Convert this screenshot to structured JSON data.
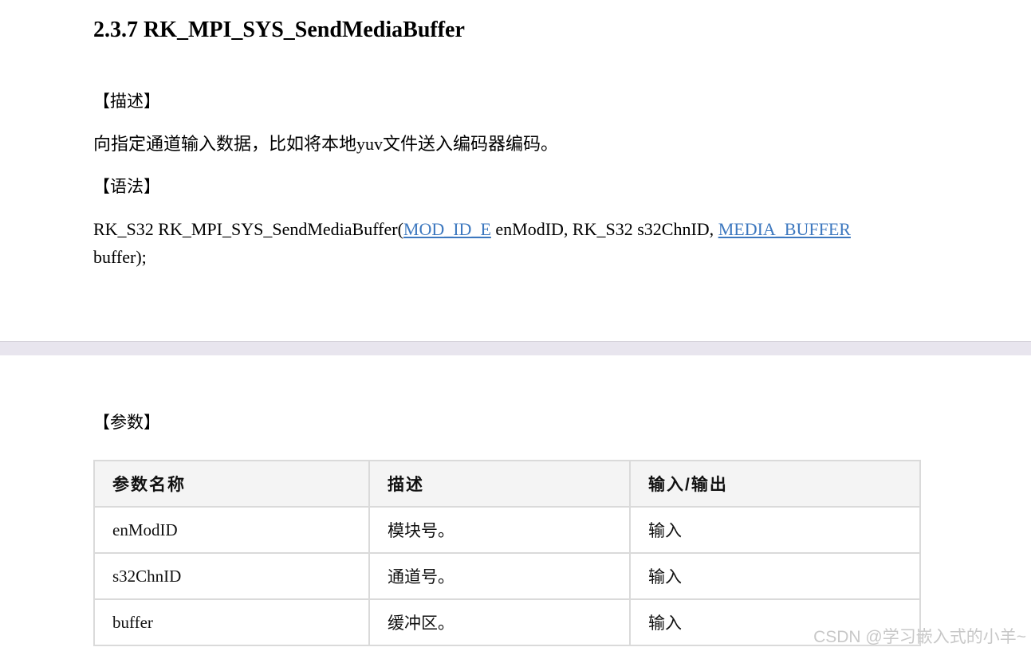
{
  "section": {
    "heading": "2.3.7 RK_MPI_SYS_SendMediaBuffer",
    "description_label": "【描述】",
    "description_text": "向指定通道输入数据，比如将本地yuv文件送入编码器编码。",
    "syntax_label": "【语法】",
    "syntax": {
      "prefix": "RK_S32 RK_MPI_SYS_SendMediaBuffer(",
      "mod_id_link": "MOD_ID_E",
      "middle": " enModID, RK_S32 s32ChnID, ",
      "media_buffer_link": "MEDIA_BUFFER",
      "suffix": "buffer);"
    },
    "params_label": "【参数】"
  },
  "params_table": {
    "headers": [
      "参数名称",
      "描述",
      "输入/输出"
    ],
    "rows": [
      [
        "enModID",
        "模块号。",
        "输入"
      ],
      [
        "s32ChnID",
        "通道号。",
        "输入"
      ],
      [
        "buffer",
        "缓冲区。",
        "输入"
      ]
    ]
  },
  "watermark": "CSDN @学习嵌入式的小羊~",
  "colors": {
    "text": "#000000",
    "link": "#3d78bf",
    "table_border": "#dadada",
    "table_header_bg": "#f4f4f4",
    "separator": "#e8e5ee",
    "watermark": "#c8c8c8"
  }
}
